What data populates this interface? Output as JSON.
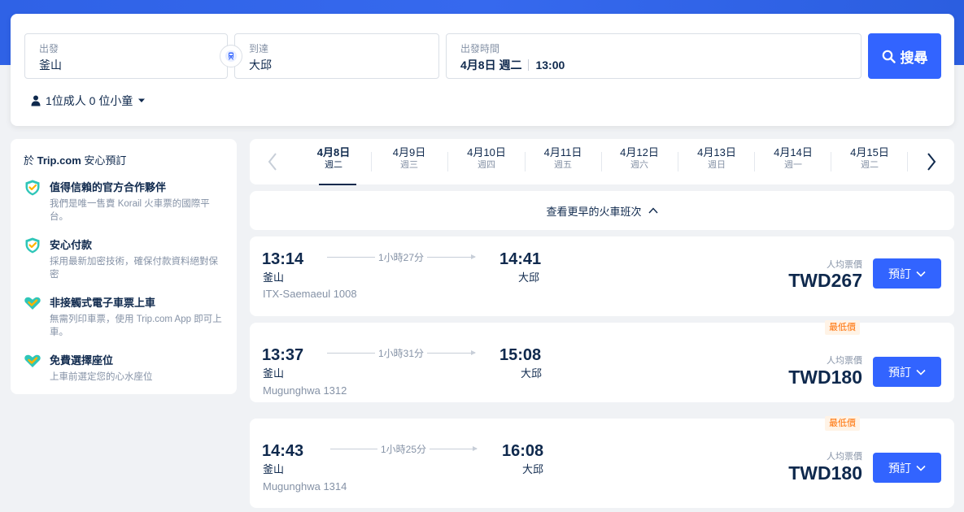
{
  "search": {
    "from_label": "出發",
    "from_value": "釜山",
    "to_label": "到達",
    "to_value": "大邱",
    "time_label": "出發時間",
    "date_value": "4月8日 週二",
    "time_value": "13:00",
    "search_button": "搜尋",
    "passengers": "1位成人 0 位小童"
  },
  "trust": {
    "title_prefix": "於 ",
    "title_brand": "Trip.com",
    "title_suffix": " 安心預訂",
    "items": [
      {
        "title": "值得信賴的官方合作夥伴",
        "desc": "我們是唯一售賣 Korail 火車票的國際平台。"
      },
      {
        "title": "安心付款",
        "desc": "採用最新加密技術，確保付款資料絕對保密"
      },
      {
        "title": "非接觸式電子車票上車",
        "desc": "無需列印車票，使用 Trip.com App 即可上車。"
      },
      {
        "title": "免費選擇座位",
        "desc": "上車前選定您的心水座位"
      }
    ]
  },
  "dates": [
    {
      "date": "4月8日",
      "weekday": "週二"
    },
    {
      "date": "4月9日",
      "weekday": "週三"
    },
    {
      "date": "4月10日",
      "weekday": "週四"
    },
    {
      "date": "4月11日",
      "weekday": "週五"
    },
    {
      "date": "4月12日",
      "weekday": "週六"
    },
    {
      "date": "4月13日",
      "weekday": "週日"
    },
    {
      "date": "4月14日",
      "weekday": "週一"
    },
    {
      "date": "4月15日",
      "weekday": "週二"
    }
  ],
  "earlier_label": "查看更早的火車班次",
  "trains": [
    {
      "dep_time": "13:14",
      "dep_station": "釜山",
      "duration": "1小時27分",
      "arr_time": "14:41",
      "arr_station": "大邱",
      "train_no": "ITX-Saemaeul 1008",
      "price_label": "人均票價",
      "price": "TWD267",
      "book": "預訂",
      "badge": ""
    },
    {
      "dep_time": "13:37",
      "dep_station": "釜山",
      "duration": "1小時31分",
      "arr_time": "15:08",
      "arr_station": "大邱",
      "train_no": "Mugunghwa 1312",
      "price_label": "人均票價",
      "price": "TWD180",
      "book": "預訂",
      "badge": "最低價"
    },
    {
      "dep_time": "14:43",
      "dep_station": "釜山",
      "duration": "1小時25分",
      "arr_time": "16:08",
      "arr_station": "大邱",
      "train_no": "Mugunghwa 1314",
      "price_label": "人均票價",
      "price": "TWD180",
      "book": "預訂",
      "badge": "最低價"
    }
  ],
  "colors": {
    "accent": "#3264ff",
    "text": "#0f294d",
    "muted": "#8592a6",
    "badge": "#ff6f00"
  },
  "icons": {
    "swap": "train-icon",
    "search": "search-icon",
    "person": "person-icon",
    "shield": "shield-check-icon"
  }
}
